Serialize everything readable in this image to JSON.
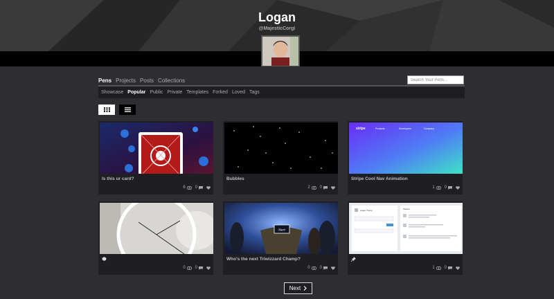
{
  "profile": {
    "name": "Logan",
    "handle": "@MajesticCorgi"
  },
  "nav": {
    "tabs": [
      "Pens",
      "Projects",
      "Posts",
      "Collections"
    ],
    "active_tab": "Pens",
    "search_placeholder": "Search Your Pens..."
  },
  "subnav": {
    "items": [
      "Showcase",
      "Popular",
      "Public",
      "Private",
      "Templates",
      "Forked",
      "Loved",
      "Tags"
    ],
    "active": "Popular"
  },
  "cards": [
    {
      "title": "Is this ur card?",
      "views": "6",
      "comments": "0",
      "icon": ""
    },
    {
      "title": "Bubbles",
      "views": "2",
      "comments": "0",
      "icon": ""
    },
    {
      "title": "Stripe Cool Nav Animation",
      "views": "1",
      "comments": "0",
      "icon": "",
      "thumb_nav": {
        "brand": "stripe",
        "items": [
          "Products",
          "Developers",
          "Company"
        ]
      }
    },
    {
      "title": "",
      "views": "0",
      "comments": "0",
      "icon": "egg-icon"
    },
    {
      "title": "Who's the next Triwizzard Champ?",
      "views": "0",
      "comments": "0",
      "icon": "",
      "thumb_label": "Start"
    },
    {
      "title": "",
      "views": "1",
      "comments": "0",
      "icon": "pin-icon",
      "thumb_texts": {
        "user": "Logan Trump",
        "tweets": "Tweets"
      }
    }
  ],
  "pagination": {
    "next_label": "Next"
  }
}
